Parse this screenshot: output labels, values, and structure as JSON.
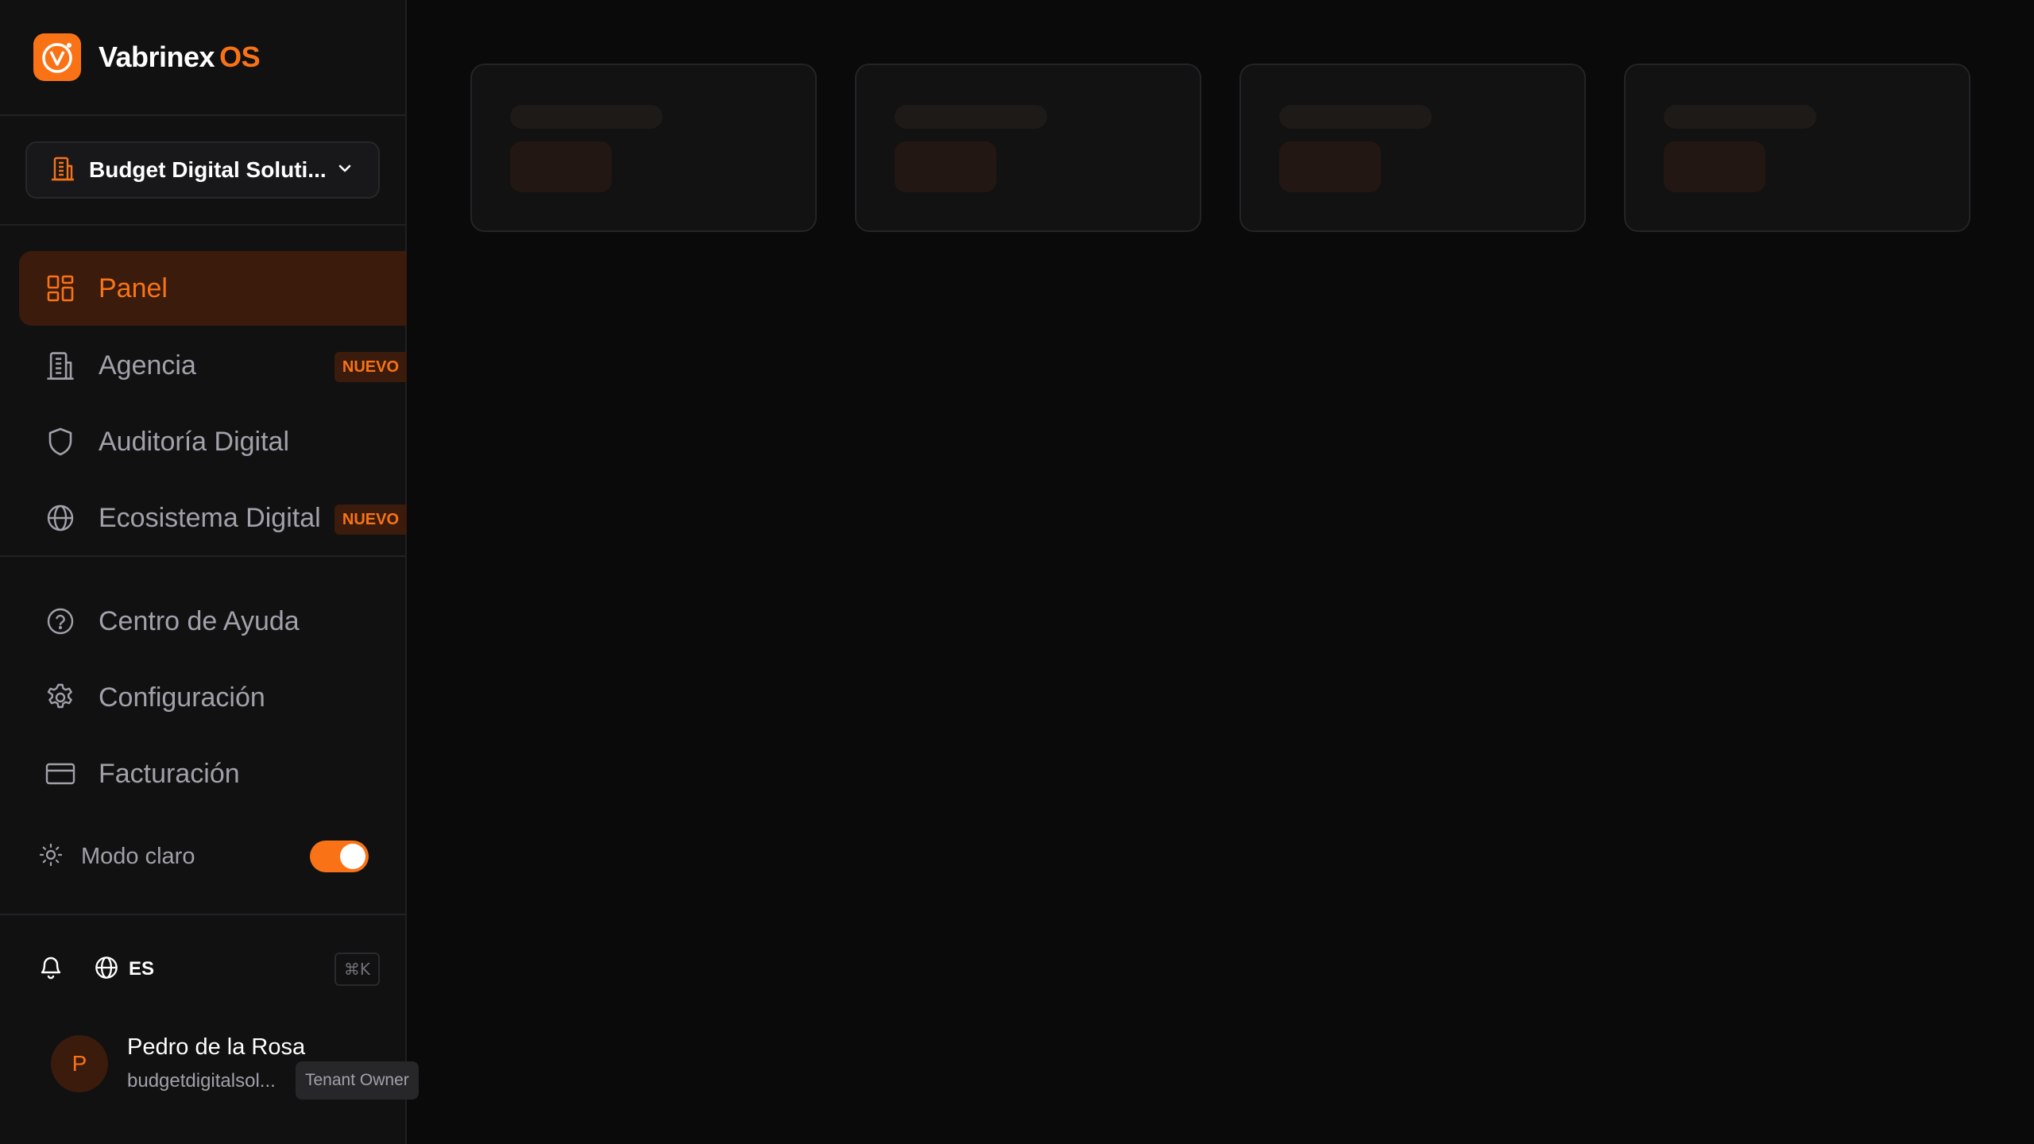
{
  "brand": {
    "name": "Vabrinex",
    "suffix": "OS",
    "logo_icon": "v-logo-icon",
    "accent": "#f97316"
  },
  "tenant": {
    "name": "Budget Digital Soluti...",
    "icon": "building-icon"
  },
  "nav_primary": [
    {
      "label": "Panel",
      "icon": "dashboard-icon",
      "active": true
    },
    {
      "label": "Agencia",
      "icon": "building-icon",
      "badge": "NUEVO"
    },
    {
      "label": "Auditoría Digital",
      "icon": "shield-icon"
    },
    {
      "label": "Ecosistema Digital",
      "icon": "globe-icon",
      "badge": "NUEVO"
    }
  ],
  "nav_secondary": [
    {
      "label": "Centro de Ayuda",
      "icon": "help-circle-icon"
    },
    {
      "label": "Configuración",
      "icon": "gear-icon"
    },
    {
      "label": "Facturación",
      "icon": "credit-card-icon"
    }
  ],
  "theme": {
    "label": "Modo claro",
    "enabled": true
  },
  "utilities": {
    "language": "ES",
    "shortcut": "⌘K"
  },
  "user": {
    "initial": "P",
    "name": "Pedro de la Rosa",
    "email": "budgetdigitalsol...",
    "role": "Tenant Owner"
  }
}
